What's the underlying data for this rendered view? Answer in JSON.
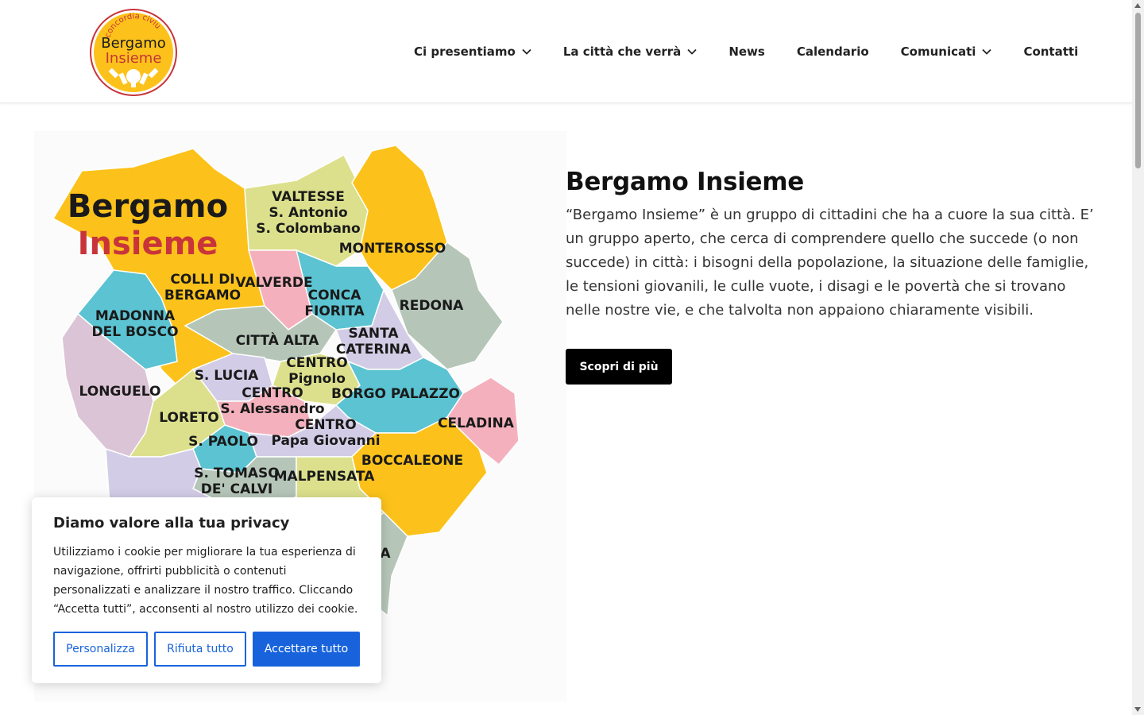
{
  "header": {
    "logo": {
      "top_text": "concordia civium",
      "name_line1": "Bergamo",
      "name_line2": "Insieme"
    },
    "nav": [
      {
        "label": "Ci presentiamo",
        "has_dropdown": true
      },
      {
        "label": "La città che verrà",
        "has_dropdown": true
      },
      {
        "label": "News",
        "has_dropdown": false
      },
      {
        "label": "Calendario",
        "has_dropdown": false
      },
      {
        "label": "Comunicati",
        "has_dropdown": true
      },
      {
        "label": "Contatti",
        "has_dropdown": false
      }
    ]
  },
  "map": {
    "title_line1": "Bergamo",
    "title_line2": "Insieme",
    "districts": [
      "VALTESSE",
      "S. Antonio",
      "S. Colombano",
      "MONTEROSSO",
      "COLLI DI",
      "BERGAMO",
      "VALVERDE",
      "CONCA",
      "FIORITA",
      "REDONA",
      "MADONNA",
      "DEL BOSCO",
      "CITTÀ ALTA",
      "SANTA",
      "CATERINA",
      "S. LUCIA",
      "CENTRO",
      "Pignolo",
      "LONGUELO",
      "CENTRO",
      "S. Alessandro",
      "BORGO PALAZZO",
      "LORETO",
      "CENTRO",
      "Papa Giovanni",
      "CELADINA",
      "S. PAOLO",
      "BOCCALEONE",
      "S. TOMASO",
      "DE' CALVI",
      "MALPENSATA",
      "A"
    ]
  },
  "main": {
    "title": "Bergamo Insieme",
    "description": "“Bergamo Insieme” è un gruppo di cittadini che ha a cuore la sua città. E’ un gruppo aperto, che cerca di comprendere quello che succede (o non succede) in città: i bisogni della popolazione, la situazione delle famiglie, le tensioni giovanili, le culle vuote, i disagi e le povertà che si trovano nelle nostre vie, e che talvolta non appaiono chiaramente visibili.",
    "cta_label": "Scopri di più"
  },
  "cookie_banner": {
    "title": "Diamo valore alla tua privacy",
    "text": "Utilizziamo i cookie per migliorare la tua esperienza di navigazione, offrirti pubblicità o contenuti personalizzati e analizzare il nostro traffico. Cliccando “Accetta tutti”, acconsenti al nostro utilizzo dei cookie.",
    "customize_label": "Personalizza",
    "reject_label": "Rifiuta tutto",
    "accept_label": "Accettare tutto"
  },
  "colors": {
    "accent_blue": "#1863dc",
    "cta_black": "#000000",
    "map_yellow": "#fcc21b",
    "map_teal": "#5bc3d1",
    "map_green": "#dce08c",
    "map_pink": "#f4b1bd",
    "map_lilac": "#d2cce6",
    "map_sage": "#b5c6b8",
    "map_mauve": "#dbc4d6"
  },
  "icons": {
    "dropdown": "chevron-down-icon"
  }
}
